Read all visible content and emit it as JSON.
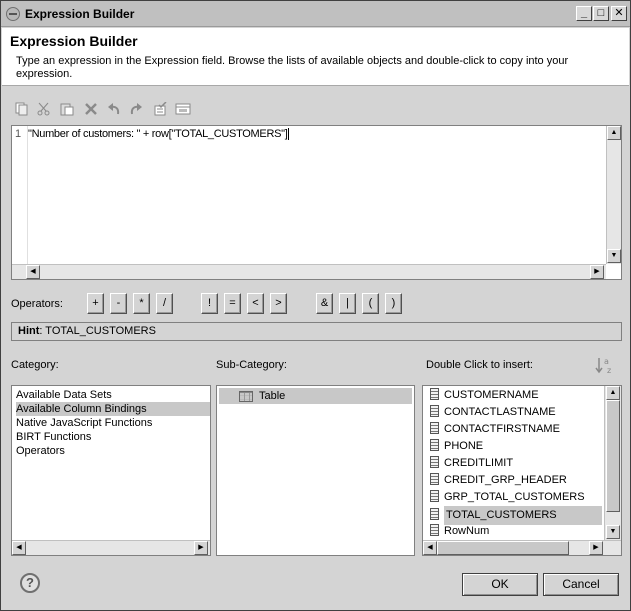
{
  "window": {
    "title": "Expression Builder",
    "controls": [
      "_",
      "□",
      "✕"
    ]
  },
  "header": {
    "title": "Expression Builder",
    "description": "Type an expression in the Expression field. Browse the lists of available objects and double-click to copy into your expression."
  },
  "toolbar": {
    "icons": [
      "copy-icon",
      "cut-icon",
      "paste-icon",
      "delete-icon",
      "undo-icon",
      "redo-icon",
      "select-all-icon",
      "validate-icon"
    ]
  },
  "editor": {
    "line_number": "1",
    "code": "\"Number of customers: \" + row[\"TOTAL_CUSTOMERS\"]"
  },
  "operators": {
    "label": "Operators:",
    "buttons": [
      "+",
      "-",
      "*",
      "/",
      "!",
      "=",
      "<",
      ">",
      "&",
      "|",
      "(",
      ")"
    ]
  },
  "hint": {
    "label": "Hint",
    "value": ": TOTAL_CUSTOMERS"
  },
  "category": {
    "label": "Category:",
    "items": [
      "Available Data Sets",
      "Available Column Bindings",
      "Native JavaScript Functions",
      "BIRT Functions",
      "Operators"
    ],
    "selected": "Available Column Bindings"
  },
  "subcategory": {
    "label": "Sub-Category:",
    "items": [
      "Table"
    ]
  },
  "insert": {
    "label": "Double Click to insert:",
    "items": [
      "CUSTOMERNAME",
      "CONTACTLASTNAME",
      "CONTACTFIRSTNAME",
      "PHONE",
      "CREDITLIMIT",
      "CREDIT_GRP_HEADER",
      "GRP_TOTAL_CUSTOMERS",
      "TOTAL_CUSTOMERS",
      "RowNum"
    ],
    "selected": "TOTAL_CUSTOMERS"
  },
  "footer": {
    "help": "?",
    "ok": "OK",
    "cancel": "Cancel"
  },
  "colors": {
    "dialog_bg": "#d4d4d4",
    "selection": "#c8c8c8",
    "header_bg": "#ffffff"
  }
}
